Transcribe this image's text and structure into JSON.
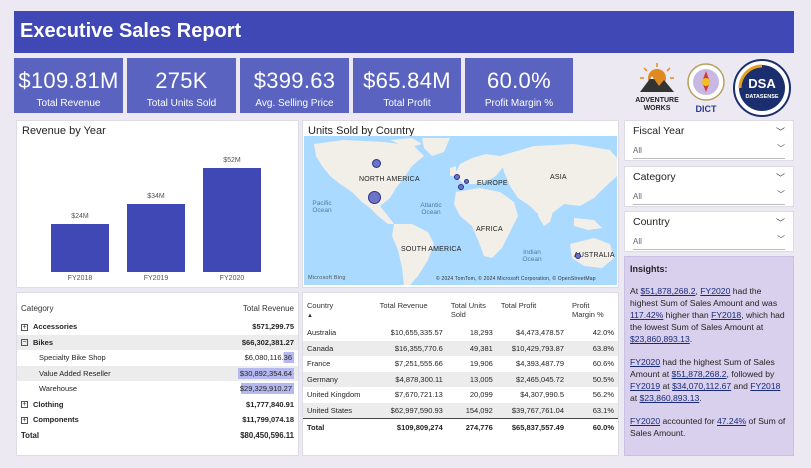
{
  "header": {
    "title": "Executive Sales Report"
  },
  "kpis": [
    {
      "value": "$109.81M",
      "label": "Total Revenue"
    },
    {
      "value": "275K",
      "label": "Total Units Sold"
    },
    {
      "value": "$399.63",
      "label": "Avg. Selling Price"
    },
    {
      "value": "$65.84M",
      "label": "Total Profit"
    },
    {
      "value": "60.0%",
      "label": "Profit Margin %"
    }
  ],
  "logos": {
    "adventure_works_text": "ADVENTURE WORKS",
    "dict_text": "DICT",
    "dsa_text": "DSA",
    "dsa_sub": "DATASENSE"
  },
  "revenue_chart": {
    "title": "Revenue by Year",
    "chart_data": {
      "type": "bar",
      "categories": [
        "FY2018",
        "FY2019",
        "FY2020"
      ],
      "values": [
        24,
        34,
        52
      ],
      "data_labels": [
        "$24M",
        "$34M",
        "$52M"
      ],
      "ylim": [
        0,
        60
      ],
      "grid": false
    }
  },
  "map": {
    "title": "Units Sold by Country",
    "labels": {
      "north_america": "NORTH AMERICA",
      "europe": "EUROPE",
      "asia": "ASIA",
      "africa": "AFRICA",
      "south_america": "SOUTH AMERICA",
      "australia": "AUSTRALIA",
      "pacific_ocean": "Pacific Ocean",
      "atlantic_ocean": "Atlantic Ocean",
      "indian_ocean": "Indian Ocean"
    },
    "bing": "Microsoft Bing",
    "credits": "© 2024 TomTom, © 2024 Microsoft Corporation, © OpenStreetMap"
  },
  "slicers": [
    {
      "title": "Fiscal Year",
      "value": "All"
    },
    {
      "title": "Category",
      "value": "All"
    },
    {
      "title": "Country",
      "value": "All"
    }
  ],
  "insights": {
    "heading": "Insights:",
    "p1": {
      "a": "At ",
      "b": "$51,878,268.2",
      "c": ", ",
      "d": "FY2020",
      "e": " had the highest Sum of Sales Amount and was ",
      "f": "117.42%",
      "g": " higher than ",
      "h": "FY2018",
      "i": ", which had the lowest Sum of Sales Amount at ",
      "j": "$23,860,893.13",
      "k": "."
    },
    "p2": {
      "a": "FY2020",
      "b": " had the highest Sum of Sales Amount at ",
      "c": "$51,878,268.2",
      "d": ", followed by ",
      "e": "FY2019",
      "f": " at ",
      "g": "$34,070,112.67",
      "h": " and ",
      "i": "FY2018",
      "j": " at ",
      "k": "$23,860,893.13",
      "l": "."
    },
    "p3": {
      "a": "FY2020",
      "b": " accounted for ",
      "c": "47.24%",
      "d": " of Sum of Sales Amount."
    }
  },
  "category_matrix": {
    "headers": [
      "Category",
      "Total Revenue"
    ],
    "rows": [
      {
        "name": "Accessories",
        "value": "$571,299.75",
        "level": 0,
        "expand": "+"
      },
      {
        "name": "Bikes",
        "value": "$66,302,381.27",
        "level": 0,
        "expand": "−"
      },
      {
        "name": "Specialty Bike Shop",
        "value": "$6,080,116.36",
        "level": 1,
        "bar": 0.21
      },
      {
        "name": "Value Added Reseller",
        "value": "$30,892,354.64",
        "level": 1,
        "bar": 1.0
      },
      {
        "name": "Warehouse",
        "value": "$29,329,910.27",
        "level": 1,
        "bar": 0.95
      },
      {
        "name": "Clothing",
        "value": "$1,777,840.91",
        "level": 0,
        "expand": "+"
      },
      {
        "name": "Components",
        "value": "$11,799,074.18",
        "level": 0,
        "expand": "+"
      }
    ],
    "total": {
      "name": "Total",
      "value": "$80,450,596.11"
    }
  },
  "country_table": {
    "headers": [
      "Country",
      "Total Revenue",
      "Total Units Sold",
      "Total Profit",
      "Profit Margin %"
    ],
    "rows": [
      [
        "Australia",
        "$10,655,335.57",
        "18,293",
        "$4,473,478.57",
        "42.0%"
      ],
      [
        "Canada",
        "$16,355,770.6",
        "49,381",
        "$10,429,793.87",
        "63.8%"
      ],
      [
        "France",
        "$7,251,555.66",
        "19,906",
        "$4,393,487.79",
        "60.6%"
      ],
      [
        "Germany",
        "$4,878,300.11",
        "13,005",
        "$2,465,045.72",
        "50.5%"
      ],
      [
        "United Kingdom",
        "$7,670,721.13",
        "20,099",
        "$4,307,990.5",
        "56.2%"
      ],
      [
        "United States",
        "$62,997,590.93",
        "154,092",
        "$39,767,761.04",
        "63.1%"
      ]
    ],
    "total": [
      "Total",
      "$109,809,274",
      "274,776",
      "$65,837,557.49",
      "60.0%"
    ]
  }
}
